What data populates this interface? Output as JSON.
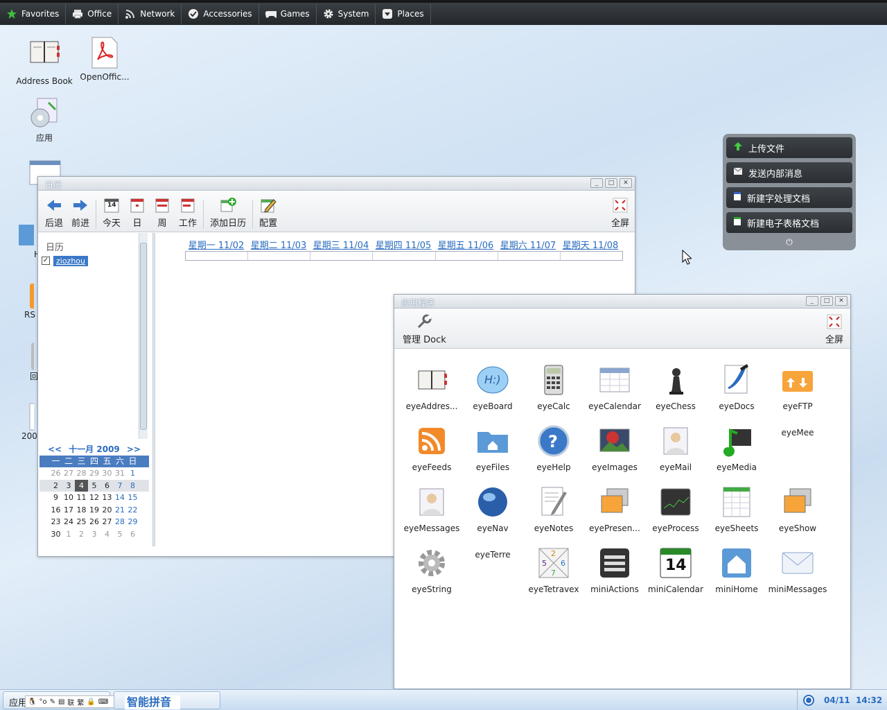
{
  "topbar": {
    "items": [
      {
        "label": "Favorites",
        "icon": "star-icon"
      },
      {
        "label": "Office",
        "icon": "printer-icon"
      },
      {
        "label": "Network",
        "icon": "rss-icon"
      },
      {
        "label": "Accessories",
        "icon": "check-icon"
      },
      {
        "label": "Games",
        "icon": "gamepad-icon"
      },
      {
        "label": "System",
        "icon": "gear-icon"
      },
      {
        "label": "Places",
        "icon": "down-icon"
      }
    ]
  },
  "desktop": {
    "address_book": "Address Book",
    "openoffice": "OpenOffic...",
    "apps": "应用",
    "rss": "RS",
    "h": "H",
    "recycle": "回",
    "num": "200"
  },
  "calendar_window": {
    "title": "日历",
    "toolbar": {
      "back": "后退",
      "forward": "前进",
      "today": "今天",
      "today_num": "14",
      "day": "日",
      "week": "周",
      "work": "工作",
      "add": "添加日历",
      "config": "配置",
      "fullscreen": "全屏"
    },
    "sidebar_title": "日历",
    "calendar_item": "ziozhou",
    "weekdays": [
      "星期一 11/02",
      "星期二 11/03",
      "星期三 11/04",
      "星期四 11/05",
      "星期五 11/06",
      "星期六 11/07",
      "星期天 11/08"
    ],
    "mini": {
      "prev": "<<",
      "next": ">>",
      "month": "十一月 2009",
      "headers": [
        "一",
        "二",
        "三",
        "四",
        "五",
        "六",
        "日"
      ],
      "weeks": [
        [
          "26",
          "27",
          "28",
          "29",
          "30",
          "31",
          "1"
        ],
        [
          "2",
          "3",
          "4",
          "5",
          "6",
          "7",
          "8"
        ],
        [
          "9",
          "10",
          "11",
          "12",
          "13",
          "14",
          "15"
        ],
        [
          "16",
          "17",
          "18",
          "19",
          "20",
          "21",
          "22"
        ],
        [
          "23",
          "24",
          "25",
          "26",
          "27",
          "28",
          "29"
        ],
        [
          "30",
          "1",
          "2",
          "3",
          "4",
          "5",
          "6"
        ]
      ]
    }
  },
  "apps_window": {
    "title": "应用程序",
    "manage": "管理 Dock",
    "fullscreen": "全屏",
    "apps": [
      "eyeAddres...",
      "eyeBoard",
      "eyeCalc",
      "eyeCalendar",
      "eyeChess",
      "eyeDocs",
      "eyeFTP",
      "eyeFeeds",
      "eyeFiles",
      "eyeHelp",
      "eyeImages",
      "eyeMail",
      "eyeMedia",
      "eyeMee",
      "eyeMessages",
      "eyeNav",
      "eyeNotes",
      "eyePresen...",
      "eyeProcess",
      "eyeSheets",
      "eyeShow",
      "eyeString",
      "eyeTerre",
      "eyeTetravex",
      "miniActions",
      "miniCalendar",
      "miniHome",
      "miniMessages"
    ],
    "mini_calendar_num": "14"
  },
  "dock": {
    "upload": "上传文件",
    "send": "发送内部消息",
    "new_doc": "新建字处理文档",
    "new_sheet": "新建电子表格文档"
  },
  "taskbar": {
    "apps": "应用",
    "ime": "智能拼音",
    "date": "04/11",
    "time": "14:32"
  }
}
